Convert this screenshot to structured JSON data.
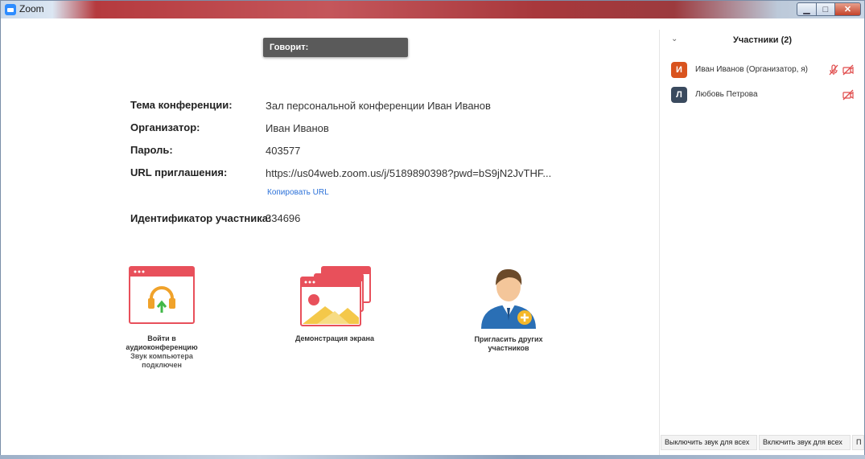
{
  "window": {
    "title": "Zoom"
  },
  "speaking": {
    "label": "Говорит:"
  },
  "meeting_info": {
    "topic_label": "Тема конференции:",
    "topic_value": "Зал персональной конференции Иван Иванов",
    "host_label": "Организатор:",
    "host_value": "Иван Иванов",
    "password_label": "Пароль:",
    "password_value": "403577",
    "url_label": "URL приглашения:",
    "url_value": "https://us04web.zoom.us/j/5189890398?pwd=bS9jN2JvTHF...",
    "copy_url": "Копировать URL",
    "participant_id_label": "Идентификатор участника:",
    "participant_id_value": "334696"
  },
  "actions": {
    "audio": {
      "label_line1": "Войти в",
      "label_line2": "аудиоконференцию",
      "sub_line1": "Звук компьютера",
      "sub_line2": "подключен"
    },
    "share": {
      "label": "Демонстрация экрана"
    },
    "invite": {
      "label_line1": "Пригласить других",
      "label_line2": "участников"
    }
  },
  "participants_panel": {
    "title": "Участники (2)",
    "participants": [
      {
        "initial": "И",
        "name": "Иван Иванов (Организатор, я)",
        "avatar_color": "#d9531e",
        "muted_mic": true,
        "video_off": true
      },
      {
        "initial": "Л",
        "name": "Любовь Петрова",
        "avatar_color": "#3a4a5e",
        "muted_mic": false,
        "video_off": true
      }
    ],
    "footer_buttons": [
      "Выключить звук для всех",
      "Включить звук для всех",
      "П"
    ]
  },
  "colors": {
    "accent_red": "#e8505b",
    "link_blue": "#2d72d9",
    "status_red": "#e04b4b"
  }
}
